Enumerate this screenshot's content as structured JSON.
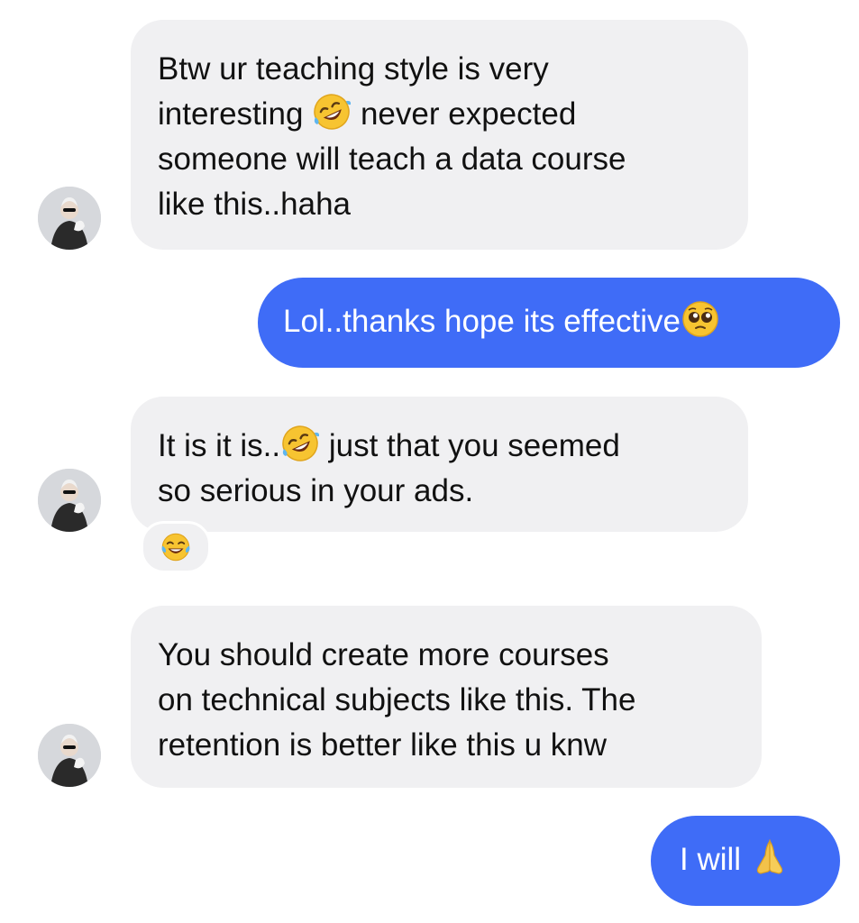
{
  "conversation": {
    "messages": [
      {
        "direction": "incoming",
        "parts": [
          "Btw ur teaching style is very",
          "interesting",
          "never expected",
          "someone will teach a data course",
          "like this..haha"
        ],
        "emoji": "rofl-emoji"
      },
      {
        "direction": "outgoing",
        "text": "Lol..thanks hope its effective",
        "emoji": "pleading-face-emoji"
      },
      {
        "direction": "incoming",
        "parts": [
          "It is it is..",
          "just that you seemed",
          "so serious in your ads."
        ],
        "emoji": "rofl-emoji",
        "reaction": "joy-emoji"
      },
      {
        "direction": "incoming",
        "parts": [
          "You should create more courses",
          "on technical subjects like this. The",
          "retention is better like this u knw"
        ]
      },
      {
        "direction": "outgoing",
        "text": "I will",
        "emoji": "folded-hands-emoji"
      }
    ]
  },
  "colors": {
    "incoming_bubble": "#f0f0f2",
    "outgoing_bubble": "#3f6cf7",
    "outgoing_text": "#ffffff"
  }
}
